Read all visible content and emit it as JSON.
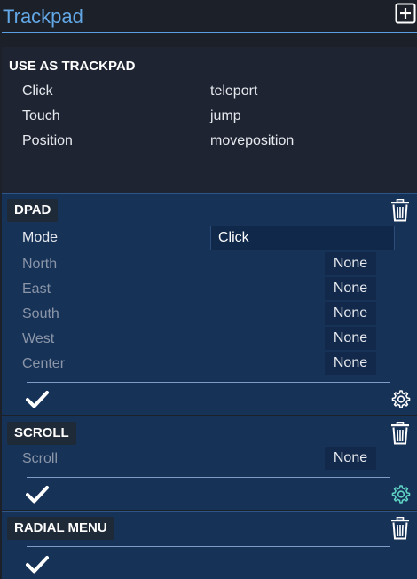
{
  "header": {
    "title": "Trackpad",
    "add_icon": "plus-square-icon"
  },
  "trackpad": {
    "section_title": "USE AS TRACKPAD",
    "rows": [
      {
        "label": "Click",
        "value": "teleport"
      },
      {
        "label": "Touch",
        "value": "jump"
      },
      {
        "label": "Position",
        "value": "moveposition"
      }
    ]
  },
  "dpad": {
    "title": "DPAD",
    "mode_label": "Mode",
    "mode_value": "Click",
    "rows": [
      {
        "label": "North",
        "value": "None"
      },
      {
        "label": "East",
        "value": "None"
      },
      {
        "label": "South",
        "value": "None"
      },
      {
        "label": "West",
        "value": "None"
      },
      {
        "label": "Center",
        "value": "None"
      }
    ]
  },
  "scroll": {
    "title": "SCROLL",
    "rows": [
      {
        "label": "Scroll",
        "value": "None"
      }
    ]
  },
  "radial": {
    "title": "RADIAL MENU"
  },
  "colors": {
    "accent": "#63a8e6",
    "group_bg": "#173257",
    "settings_active": "#5fd3c4"
  }
}
